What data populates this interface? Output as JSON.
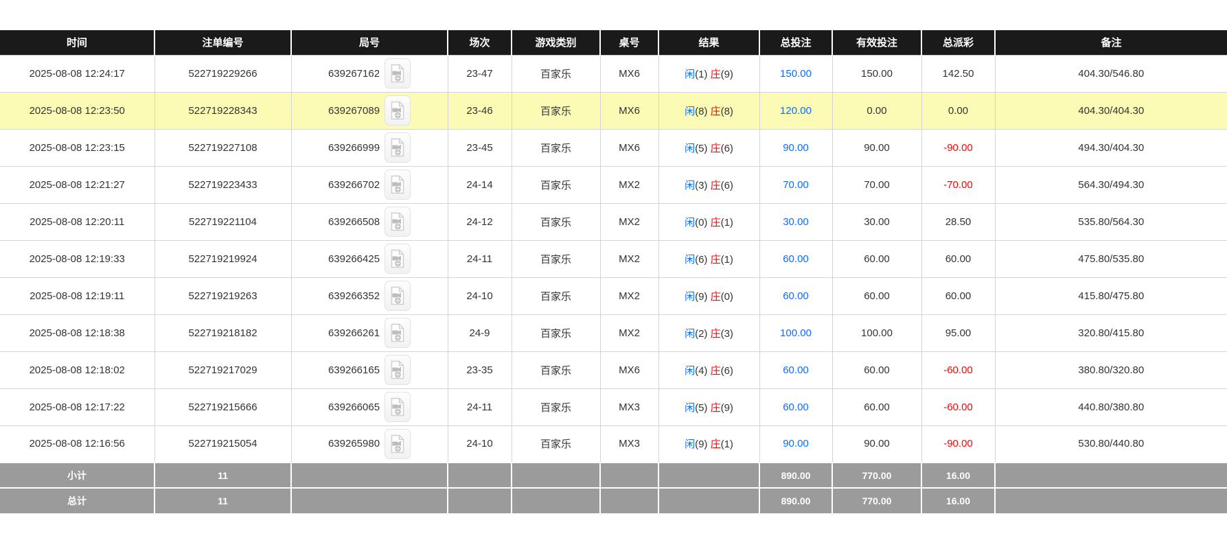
{
  "colors": {
    "header_bg": "#1a1a1a",
    "header_text": "#ffffff",
    "row_highlight_yellow": "#fbfbb5",
    "footer_bg": "#9b9b9b",
    "player_and_amount_blue": "#0b6cff",
    "banker_and_negative_red": "#ff0000"
  },
  "icons": {
    "video_replay": "video-file-icon"
  },
  "table": {
    "columns": [
      {
        "key": "time",
        "label": "时间"
      },
      {
        "key": "bet_id",
        "label": "注单编号"
      },
      {
        "key": "game_no",
        "label": "局号"
      },
      {
        "key": "session",
        "label": "场次"
      },
      {
        "key": "game_type",
        "label": "游戏类别"
      },
      {
        "key": "table_no",
        "label": "桌号"
      },
      {
        "key": "result",
        "label": "结果"
      },
      {
        "key": "total_bet",
        "label": "总投注"
      },
      {
        "key": "valid_bet",
        "label": "有效投注"
      },
      {
        "key": "payout",
        "label": "总派彩"
      },
      {
        "key": "remark",
        "label": "备注"
      }
    ],
    "rows": [
      {
        "time": "2025-08-08 12:24:17",
        "bet_id": "522719229266",
        "game_no": "639267162",
        "session": "23-47",
        "game_type": "百家乐",
        "table_no": "MX6",
        "result": {
          "player_label": "闲",
          "player_score": "(1)",
          "banker_label": "庄",
          "banker_score": "(9)"
        },
        "total_bet": "150.00",
        "valid_bet": "150.00",
        "payout": "142.50",
        "remark": "404.30/546.80",
        "highlighted": false
      },
      {
        "time": "2025-08-08 12:23:50",
        "bet_id": "522719228343",
        "game_no": "639267089",
        "session": "23-46",
        "game_type": "百家乐",
        "table_no": "MX6",
        "result": {
          "player_label": "闲",
          "player_score": "(8)",
          "banker_label": "庄",
          "banker_score": "(8)"
        },
        "total_bet": "120.00",
        "valid_bet": "0.00",
        "payout": "0.00",
        "remark": "404.30/404.30",
        "highlighted": true
      },
      {
        "time": "2025-08-08 12:23:15",
        "bet_id": "522719227108",
        "game_no": "639266999",
        "session": "23-45",
        "game_type": "百家乐",
        "table_no": "MX6",
        "result": {
          "player_label": "闲",
          "player_score": "(5)",
          "banker_label": "庄",
          "banker_score": "(6)"
        },
        "total_bet": "90.00",
        "valid_bet": "90.00",
        "payout": "-90.00",
        "remark": "494.30/404.30",
        "highlighted": false
      },
      {
        "time": "2025-08-08 12:21:27",
        "bet_id": "522719223433",
        "game_no": "639266702",
        "session": "24-14",
        "game_type": "百家乐",
        "table_no": "MX2",
        "result": {
          "player_label": "闲",
          "player_score": "(3)",
          "banker_label": "庄",
          "banker_score": "(6)"
        },
        "total_bet": "70.00",
        "valid_bet": "70.00",
        "payout": "-70.00",
        "remark": "564.30/494.30",
        "highlighted": false
      },
      {
        "time": "2025-08-08 12:20:11",
        "bet_id": "522719221104",
        "game_no": "639266508",
        "session": "24-12",
        "game_type": "百家乐",
        "table_no": "MX2",
        "result": {
          "player_label": "闲",
          "player_score": "(0)",
          "banker_label": "庄",
          "banker_score": "(1)"
        },
        "total_bet": "30.00",
        "valid_bet": "30.00",
        "payout": "28.50",
        "remark": "535.80/564.30",
        "highlighted": false
      },
      {
        "time": "2025-08-08 12:19:33",
        "bet_id": "522719219924",
        "game_no": "639266425",
        "session": "24-11",
        "game_type": "百家乐",
        "table_no": "MX2",
        "result": {
          "player_label": "闲",
          "player_score": "(6)",
          "banker_label": "庄",
          "banker_score": "(1)"
        },
        "total_bet": "60.00",
        "valid_bet": "60.00",
        "payout": "60.00",
        "remark": "475.80/535.80",
        "highlighted": false
      },
      {
        "time": "2025-08-08 12:19:11",
        "bet_id": "522719219263",
        "game_no": "639266352",
        "session": "24-10",
        "game_type": "百家乐",
        "table_no": "MX2",
        "result": {
          "player_label": "闲",
          "player_score": "(9)",
          "banker_label": "庄",
          "banker_score": "(0)"
        },
        "total_bet": "60.00",
        "valid_bet": "60.00",
        "payout": "60.00",
        "remark": "415.80/475.80",
        "highlighted": false
      },
      {
        "time": "2025-08-08 12:18:38",
        "bet_id": "522719218182",
        "game_no": "639266261",
        "session": "24-9",
        "game_type": "百家乐",
        "table_no": "MX2",
        "result": {
          "player_label": "闲",
          "player_score": "(2)",
          "banker_label": "庄",
          "banker_score": "(3)"
        },
        "total_bet": "100.00",
        "valid_bet": "100.00",
        "payout": "95.00",
        "remark": "320.80/415.80",
        "highlighted": false
      },
      {
        "time": "2025-08-08 12:18:02",
        "bet_id": "522719217029",
        "game_no": "639266165",
        "session": "23-35",
        "game_type": "百家乐",
        "table_no": "MX6",
        "result": {
          "player_label": "闲",
          "player_score": "(4)",
          "banker_label": "庄",
          "banker_score": "(6)"
        },
        "total_bet": "60.00",
        "valid_bet": "60.00",
        "payout": "-60.00",
        "remark": "380.80/320.80",
        "highlighted": false
      },
      {
        "time": "2025-08-08 12:17:22",
        "bet_id": "522719215666",
        "game_no": "639266065",
        "session": "24-11",
        "game_type": "百家乐",
        "table_no": "MX3",
        "result": {
          "player_label": "闲",
          "player_score": "(5)",
          "banker_label": "庄",
          "banker_score": "(9)"
        },
        "total_bet": "60.00",
        "valid_bet": "60.00",
        "payout": "-60.00",
        "remark": "440.80/380.80",
        "highlighted": false
      },
      {
        "time": "2025-08-08 12:16:56",
        "bet_id": "522719215054",
        "game_no": "639265980",
        "session": "24-10",
        "game_type": "百家乐",
        "table_no": "MX3",
        "result": {
          "player_label": "闲",
          "player_score": "(9)",
          "banker_label": "庄",
          "banker_score": "(1)"
        },
        "total_bet": "90.00",
        "valid_bet": "90.00",
        "payout": "-90.00",
        "remark": "530.80/440.80",
        "highlighted": false
      }
    ],
    "footer_rows": [
      {
        "label": "小计",
        "count": "11",
        "total_bet": "890.00",
        "valid_bet": "770.00",
        "payout": "16.00"
      },
      {
        "label": "总计",
        "count": "11",
        "total_bet": "890.00",
        "valid_bet": "770.00",
        "payout": "16.00"
      }
    ]
  }
}
